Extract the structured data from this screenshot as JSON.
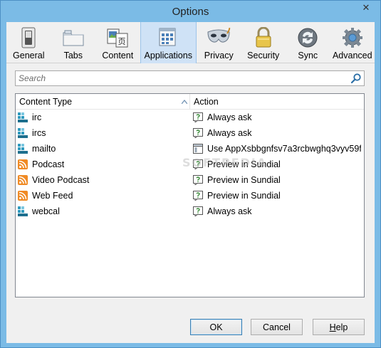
{
  "window": {
    "title": "Options",
    "close_glyph": "✕"
  },
  "toolbar": {
    "panes": [
      {
        "label": "General",
        "icon": "switch-icon"
      },
      {
        "label": "Tabs",
        "icon": "folder-tabs-icon"
      },
      {
        "label": "Content",
        "icon": "content-page-icon"
      },
      {
        "label": "Applications",
        "icon": "applications-icon",
        "selected": true
      },
      {
        "label": "Privacy",
        "icon": "mask-icon"
      },
      {
        "label": "Security",
        "icon": "padlock-icon"
      },
      {
        "label": "Sync",
        "icon": "sync-icon"
      },
      {
        "label": "Advanced",
        "icon": "gear-icon"
      }
    ]
  },
  "search": {
    "placeholder": "Search",
    "value": ""
  },
  "list": {
    "columns": {
      "type": "Content Type",
      "action": "Action"
    },
    "rows": [
      {
        "type": "irc",
        "type_icon": "protocol-icon",
        "action": "Always ask",
        "action_icon": "ask-icon"
      },
      {
        "type": "ircs",
        "type_icon": "protocol-icon",
        "action": "Always ask",
        "action_icon": "ask-icon"
      },
      {
        "type": "mailto",
        "type_icon": "protocol-icon",
        "action": "Use AppXsbbgnfsv7a3rcbwghq3vyv59f...",
        "action_icon": "app-window-icon"
      },
      {
        "type": "Podcast",
        "type_icon": "feed-icon",
        "action": "Preview in Sundial",
        "action_icon": "ask-icon"
      },
      {
        "type": "Video Podcast",
        "type_icon": "feed-icon",
        "action": "Preview in Sundial",
        "action_icon": "ask-icon"
      },
      {
        "type": "Web Feed",
        "type_icon": "feed-icon",
        "action": "Preview in Sundial",
        "action_icon": "ask-icon"
      },
      {
        "type": "webcal",
        "type_icon": "protocol-icon",
        "action": "Always ask",
        "action_icon": "ask-icon"
      }
    ]
  },
  "buttons": {
    "ok": "OK",
    "cancel": "Cancel",
    "help_first": "H",
    "help_rest": "elp"
  },
  "watermark": "SOFTPEDIA",
  "colors": {
    "frame": "#7bbbe6",
    "selected_pane": "#cfe2f6",
    "feed_orange": "#f08a24",
    "protocol_teal": "#2f9bbf"
  }
}
